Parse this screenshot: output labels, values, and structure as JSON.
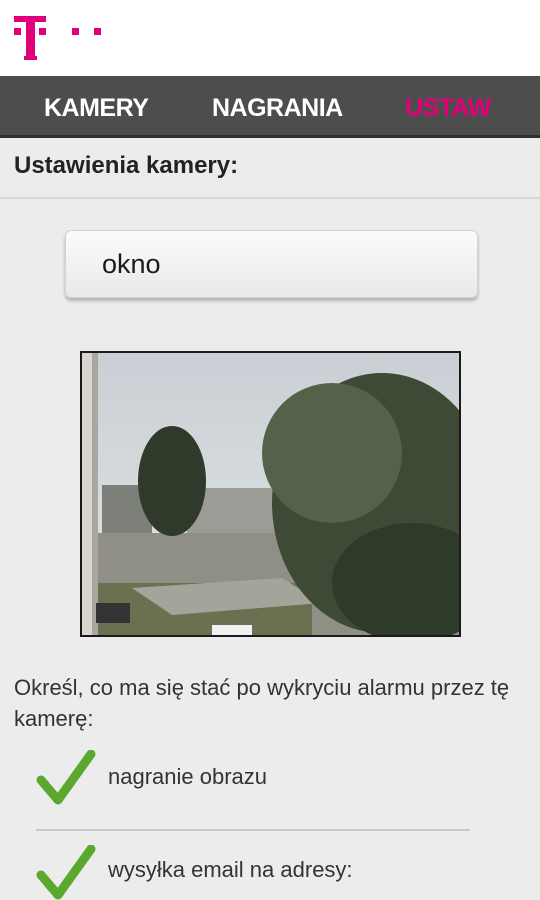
{
  "tabs": [
    {
      "label": "KAMERY",
      "active": false
    },
    {
      "label": "NAGRANIA",
      "active": false
    },
    {
      "label": "USTAW",
      "active": true
    }
  ],
  "colors": {
    "brand": "#e2007a",
    "tabbar": "#4d4d4d",
    "check": "#5aa82e"
  },
  "settings": {
    "title": "Ustawienia kamery:",
    "camera_name": "okno",
    "prompt": "Określ, co ma się stać po wykryciu alarmu przez tę kamerę:",
    "options": [
      {
        "label": "nagranie obrazu",
        "checked": true
      },
      {
        "label": "wysyłka email na adresy:",
        "checked": true
      }
    ]
  },
  "icons": {
    "logo": "t-logo",
    "option_icon": "check-icon"
  }
}
